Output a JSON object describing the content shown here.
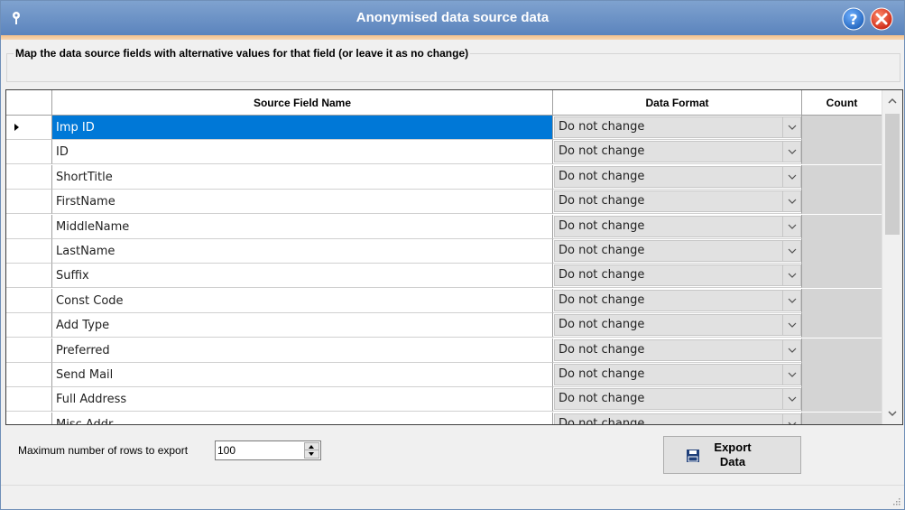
{
  "window": {
    "title": "Anonymised data source data",
    "accent_color": "#5b84bd"
  },
  "group": {
    "legend": "Map the data source fields with alternative values for that field (or leave it as no change)"
  },
  "grid": {
    "columns": [
      "Source Field Name",
      "Data Format",
      "Count"
    ],
    "rows": [
      {
        "field": "Imp ID",
        "format": "Do not change"
      },
      {
        "field": "ID",
        "format": "Do not change"
      },
      {
        "field": "ShortTitle",
        "format": "Do not change"
      },
      {
        "field": "FirstName",
        "format": "Do not change"
      },
      {
        "field": "MiddleName",
        "format": "Do not change"
      },
      {
        "field": "LastName",
        "format": "Do not change"
      },
      {
        "field": "Suffix",
        "format": "Do not change"
      },
      {
        "field": "Const Code",
        "format": "Do not change"
      },
      {
        "field": "Add Type",
        "format": "Do not change"
      },
      {
        "field": "Preferred",
        "format": "Do not change"
      },
      {
        "field": "Send Mail",
        "format": "Do not change"
      },
      {
        "field": "Full Address",
        "format": "Do not change"
      },
      {
        "field": "Misc Addr",
        "format": "Do not change"
      }
    ],
    "selected_index": 0
  },
  "footer": {
    "max_rows_label": "Maximum number of rows to export",
    "max_rows_value": "100",
    "export_label_line1": "Export",
    "export_label_line2": "Data"
  },
  "icons": {
    "title": "pin-icon",
    "help": "help-icon",
    "close": "close-icon",
    "export": "floppy-disk-icon"
  }
}
